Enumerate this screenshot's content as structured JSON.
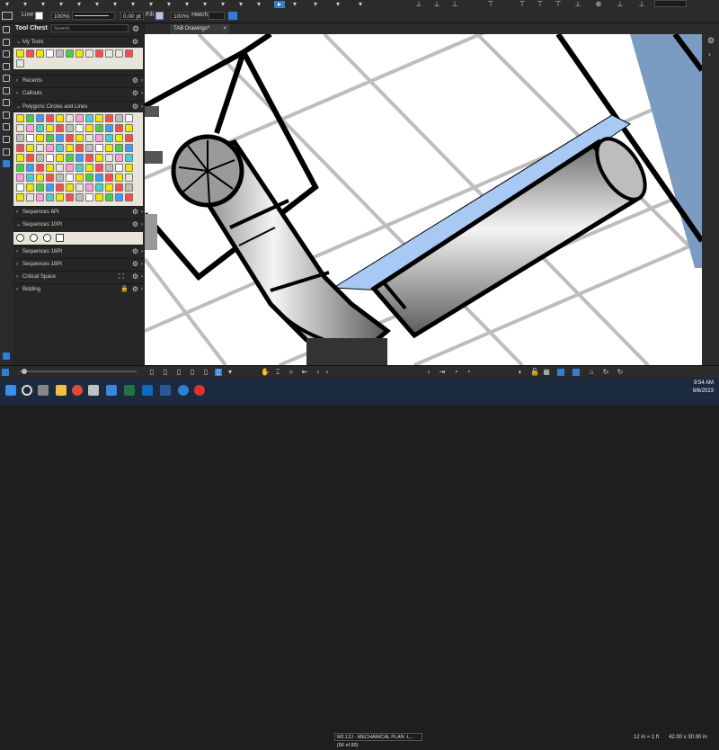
{
  "app": {
    "document_tab": "TAB Drawings*",
    "tab_close": "×"
  },
  "properties_bar": {
    "line_label": "Line",
    "line_opacity": "100%",
    "line_width": "0.00 pt",
    "fill_label": "Fill",
    "fill_opacity": "100%",
    "hatch_label": "Hatch:"
  },
  "tool_chest": {
    "title": "Tool Chest",
    "search_placeholder": "Search",
    "sections": [
      {
        "label": "My Tools",
        "expanded": true
      },
      {
        "label": "Recents",
        "expanded": false
      },
      {
        "label": "Callouts",
        "expanded": false
      },
      {
        "label": "Polygons Circles and Lines",
        "expanded": true
      },
      {
        "label": "Sequences 6Pt",
        "expanded": false
      },
      {
        "label": "Sequences 10Pt",
        "expanded": true
      },
      {
        "label": "Sequences 16Pt",
        "expanded": false
      },
      {
        "label": "Sequences 18Pt",
        "expanded": false
      },
      {
        "label": "Critical Space",
        "expanded": false
      },
      {
        "label": "Bidding",
        "expanded": false
      }
    ]
  },
  "status_bar": {
    "page_label": "M2.12J - MECHANICAL PLAN -L... (56 of 83)",
    "scale": "12 in = 1 ft",
    "size": "42.00 x 30.00 in"
  },
  "taskbar": {
    "time": "9:54 AM",
    "date": "9/6/2023"
  },
  "colors": {
    "chrome": "#2b2b2b",
    "canvas": "#ffffff",
    "duct_blue": "#a9c9f5",
    "steel_blue": "#7b9bc2",
    "accent": "#2f7fd6"
  }
}
